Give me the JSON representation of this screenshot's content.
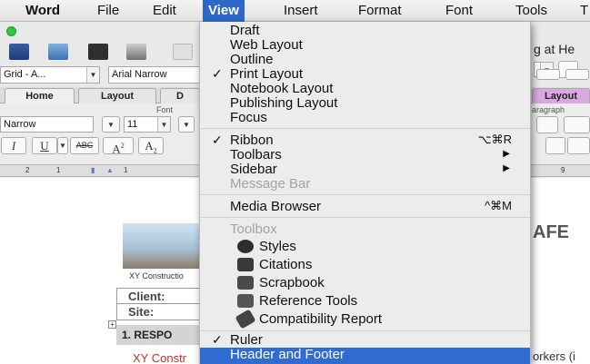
{
  "menubar": {
    "app": "Word",
    "file": "File",
    "edit": "Edit",
    "view": "View",
    "insert": "Insert",
    "format": "Format",
    "font": "Font",
    "tools": "Tools",
    "cut": "T"
  },
  "toolbar": {
    "grid_combo": "Grid - A...",
    "font_combo": "Arial Narrow",
    "font_name": "Narrow",
    "font_size": "11",
    "title_peek": "g at He"
  },
  "tabs": {
    "home": "Home",
    "layout": "Layout",
    "design_peek": "D",
    "layout_right": "Layout"
  },
  "ribbon": {
    "font_group": "Font",
    "paragraph_group": "aragraph"
  },
  "format_buttons": {
    "italic": "I",
    "underline": "U",
    "strike": "ABC",
    "superscript": "A",
    "sub_a": "A",
    "sub_2": "2",
    "super_2": "2"
  },
  "ruler": {
    "l2": "2",
    "l1": "1",
    "r1": "1",
    "r9": "9"
  },
  "document": {
    "company": "XY Constructio",
    "client": "Client:",
    "site": "Site:",
    "section": "1.  RESPO",
    "red_text": "XY Constr",
    "heading_peek": "AFE",
    "workers_peek": "orkers (i"
  },
  "menu": {
    "draft": "Draft",
    "web_layout": "Web Layout",
    "outline": "Outline",
    "print_layout": "Print Layout",
    "notebook_layout": "Notebook Layout",
    "publishing_layout": "Publishing Layout",
    "focus": "Focus",
    "ribbon": "Ribbon",
    "ribbon_shortcut": "⌥⌘R",
    "toolbars": "Toolbars",
    "sidebar": "Sidebar",
    "message_bar": "Message Bar",
    "media_browser": "Media Browser",
    "media_shortcut": "^⌘M",
    "toolbox": "Toolbox",
    "styles": "Styles",
    "citations": "Citations",
    "scrapbook": "Scrapbook",
    "reference_tools": "Reference Tools",
    "compatibility_report": "Compatibility Report",
    "ruler": "Ruler",
    "header_footer": "Header and Footer",
    "check": "✓",
    "submenu_arrow": "▶"
  },
  "colors": {
    "menu_highlight": "#2f6bd0",
    "accent_red": "#c0312b"
  }
}
